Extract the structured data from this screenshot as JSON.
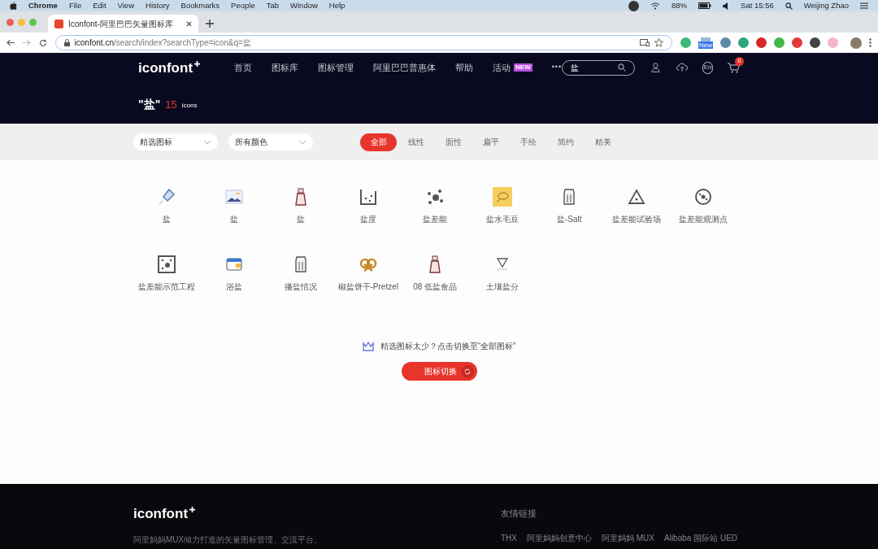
{
  "menubar": {
    "app": "Chrome",
    "menus": [
      "File",
      "Edit",
      "View",
      "History",
      "Bookmarks",
      "People",
      "Tab",
      "Window",
      "Help"
    ],
    "battery": "88%",
    "clock": "Sat 15:56",
    "user": "Weijing Zhao"
  },
  "browser": {
    "tab_title": "Iconfont-阿里巴巴矢量图标库",
    "url_host": "iconfont.cn",
    "url_path": "/search/index?searchType=icon&q=盐",
    "extension_badge": "New"
  },
  "header": {
    "logo": "iconfont",
    "nav": [
      {
        "label": "首页"
      },
      {
        "label": "图标库"
      },
      {
        "label": "图标管理"
      },
      {
        "label": "阿里巴巴普惠体"
      },
      {
        "label": "帮助"
      },
      {
        "label": "活动",
        "badge": "NEW"
      }
    ],
    "more": "•••",
    "search_value": "盐",
    "lang": "En",
    "cart_count": "0"
  },
  "result": {
    "query": "\"盐\"",
    "count": "15",
    "unit": "icons"
  },
  "filters": {
    "dropdowns": [
      "精选图标",
      "所有颜色"
    ],
    "styles": [
      {
        "label": "全部",
        "selected": true
      },
      {
        "label": "线性",
        "selected": false
      },
      {
        "label": "面性",
        "selected": false
      },
      {
        "label": "扁平",
        "selected": false
      },
      {
        "label": "手绘",
        "selected": false
      },
      {
        "label": "简约",
        "selected": false
      },
      {
        "label": "精美",
        "selected": false
      }
    ]
  },
  "icons": [
    {
      "name": "盐",
      "kind": "shaker"
    },
    {
      "name": "盐",
      "kind": "landscape"
    },
    {
      "name": "盐",
      "kind": "bottle"
    },
    {
      "name": "盐度",
      "kind": "beaker"
    },
    {
      "name": "盐差能",
      "kind": "dots"
    },
    {
      "name": "盐水毛豆",
      "kind": "tile"
    },
    {
      "name": "盐-Salt",
      "kind": "jar"
    },
    {
      "name": "盐差能试验场",
      "kind": "triangle"
    },
    {
      "name": "盐差能观测点",
      "kind": "circle"
    },
    {
      "name": "盐差能示范工程",
      "kind": "square"
    },
    {
      "name": "浴盐",
      "kind": "card"
    },
    {
      "name": "播盐情况",
      "kind": "jar"
    },
    {
      "name": "椒盐饼干-Pretzel",
      "kind": "pretzel"
    },
    {
      "name": "08 低盐食品",
      "kind": "bottle"
    },
    {
      "name": "土壤盐分",
      "kind": "funnel"
    }
  ],
  "hint": {
    "text": "精选图标太少？点击切换至“全部图标”",
    "button": "图标切换"
  },
  "footer": {
    "logo": "iconfont",
    "description": "阿里妈妈MUX倾力打造的矢量图标管理、交流平台。",
    "links_title": "友情链接",
    "links": [
      "THX",
      "阿里妈妈创意中心",
      "阿里妈妈 MUX",
      "Alibaba 国际站 UED"
    ]
  }
}
